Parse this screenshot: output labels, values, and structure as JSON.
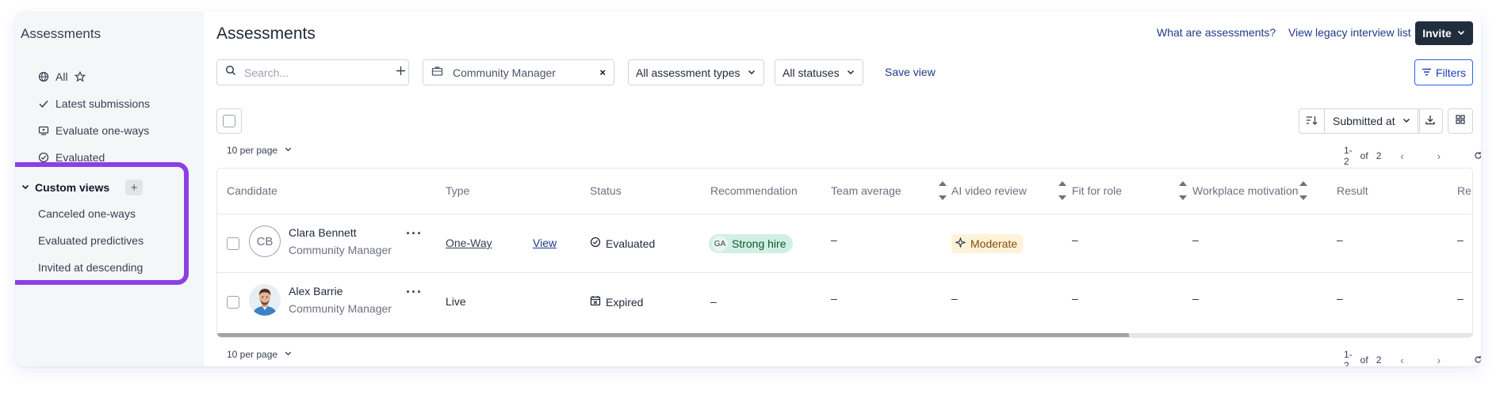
{
  "sidebar": {
    "title": "Assessments",
    "items": [
      {
        "label": "All",
        "icon": "globe-icon"
      },
      {
        "label": "Latest submissions",
        "icon": "check-icon"
      },
      {
        "label": "Evaluate one-ways",
        "icon": "screen-icon"
      },
      {
        "label": "Evaluated",
        "icon": "check-circle-icon"
      }
    ],
    "custom_views": {
      "title": "Custom views",
      "add_label": "+",
      "items": [
        "Canceled one-ways",
        "Evaluated predictives",
        "Invited at descending"
      ]
    }
  },
  "header": {
    "title": "Assessments",
    "link_what": "What are assessments?",
    "link_legacy": "View legacy interview list",
    "invite_label": "Invite"
  },
  "toolbar": {
    "search_placeholder": "Search...",
    "job_chip": "Community Manager",
    "chip_clear": "×",
    "type_filter": "All assessment types",
    "status_filter": "All statuses",
    "save_view": "Save view",
    "filters_label": "Filters",
    "sort_label": "Submitted at"
  },
  "pagination": {
    "per_page": "10 per page",
    "range": "1-2",
    "of": "of",
    "total": "2"
  },
  "table": {
    "columns": [
      "Candidate",
      "Type",
      "Status",
      "Recommendation",
      "Team average",
      "AI video review",
      "Fit for role",
      "Workplace motivation",
      "Result",
      "Re"
    ],
    "rows": [
      {
        "initials": "CB",
        "name": "Clara Bennett",
        "role": "Community Manager",
        "type": "One-Way",
        "view": "View",
        "status": "Evaluated",
        "recommendation_tag": "GA",
        "recommendation": "Strong hire",
        "team_average": "–",
        "ai_video_review": "Moderate",
        "fit_for_role": "–",
        "workplace_motivation": "–",
        "result": "–",
        "last": "–"
      },
      {
        "initials": "",
        "name": "Alex Barrie",
        "role": "Community Manager",
        "type": "Live",
        "view": "",
        "status": "Expired",
        "recommendation": "–",
        "team_average": "–",
        "ai_video_review": "–",
        "fit_for_role": "–",
        "workplace_motivation": "–",
        "result": "–",
        "last": "–"
      }
    ]
  },
  "colors": {
    "custom_views_highlight": "#8b3fe8",
    "invite_bg": "#1f2d3d",
    "link": "#1e3a8a",
    "strong_hire_bg": "#d1f0e4",
    "moderate_bg": "#fdf3d8"
  }
}
